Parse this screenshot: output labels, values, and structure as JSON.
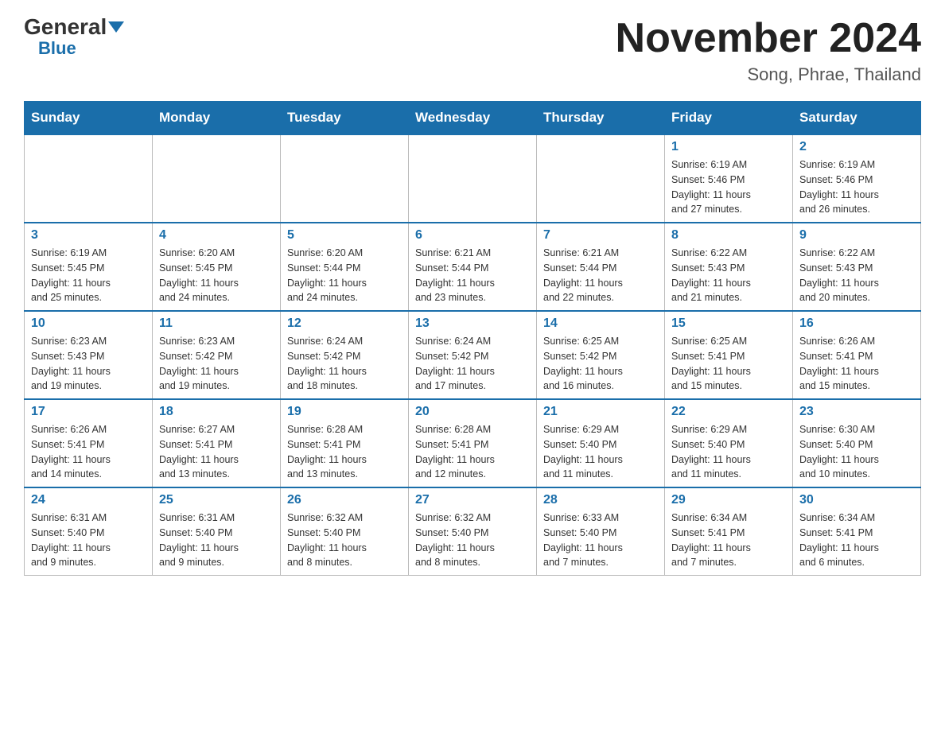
{
  "header": {
    "logo_general": "General",
    "logo_blue": "Blue",
    "month_title": "November 2024",
    "location": "Song, Phrae, Thailand"
  },
  "weekdays": [
    "Sunday",
    "Monday",
    "Tuesday",
    "Wednesday",
    "Thursday",
    "Friday",
    "Saturday"
  ],
  "weeks": [
    [
      {
        "day": "",
        "info": ""
      },
      {
        "day": "",
        "info": ""
      },
      {
        "day": "",
        "info": ""
      },
      {
        "day": "",
        "info": ""
      },
      {
        "day": "",
        "info": ""
      },
      {
        "day": "1",
        "info": "Sunrise: 6:19 AM\nSunset: 5:46 PM\nDaylight: 11 hours\nand 27 minutes."
      },
      {
        "day": "2",
        "info": "Sunrise: 6:19 AM\nSunset: 5:46 PM\nDaylight: 11 hours\nand 26 minutes."
      }
    ],
    [
      {
        "day": "3",
        "info": "Sunrise: 6:19 AM\nSunset: 5:45 PM\nDaylight: 11 hours\nand 25 minutes."
      },
      {
        "day": "4",
        "info": "Sunrise: 6:20 AM\nSunset: 5:45 PM\nDaylight: 11 hours\nand 24 minutes."
      },
      {
        "day": "5",
        "info": "Sunrise: 6:20 AM\nSunset: 5:44 PM\nDaylight: 11 hours\nand 24 minutes."
      },
      {
        "day": "6",
        "info": "Sunrise: 6:21 AM\nSunset: 5:44 PM\nDaylight: 11 hours\nand 23 minutes."
      },
      {
        "day": "7",
        "info": "Sunrise: 6:21 AM\nSunset: 5:44 PM\nDaylight: 11 hours\nand 22 minutes."
      },
      {
        "day": "8",
        "info": "Sunrise: 6:22 AM\nSunset: 5:43 PM\nDaylight: 11 hours\nand 21 minutes."
      },
      {
        "day": "9",
        "info": "Sunrise: 6:22 AM\nSunset: 5:43 PM\nDaylight: 11 hours\nand 20 minutes."
      }
    ],
    [
      {
        "day": "10",
        "info": "Sunrise: 6:23 AM\nSunset: 5:43 PM\nDaylight: 11 hours\nand 19 minutes."
      },
      {
        "day": "11",
        "info": "Sunrise: 6:23 AM\nSunset: 5:42 PM\nDaylight: 11 hours\nand 19 minutes."
      },
      {
        "day": "12",
        "info": "Sunrise: 6:24 AM\nSunset: 5:42 PM\nDaylight: 11 hours\nand 18 minutes."
      },
      {
        "day": "13",
        "info": "Sunrise: 6:24 AM\nSunset: 5:42 PM\nDaylight: 11 hours\nand 17 minutes."
      },
      {
        "day": "14",
        "info": "Sunrise: 6:25 AM\nSunset: 5:42 PM\nDaylight: 11 hours\nand 16 minutes."
      },
      {
        "day": "15",
        "info": "Sunrise: 6:25 AM\nSunset: 5:41 PM\nDaylight: 11 hours\nand 15 minutes."
      },
      {
        "day": "16",
        "info": "Sunrise: 6:26 AM\nSunset: 5:41 PM\nDaylight: 11 hours\nand 15 minutes."
      }
    ],
    [
      {
        "day": "17",
        "info": "Sunrise: 6:26 AM\nSunset: 5:41 PM\nDaylight: 11 hours\nand 14 minutes."
      },
      {
        "day": "18",
        "info": "Sunrise: 6:27 AM\nSunset: 5:41 PM\nDaylight: 11 hours\nand 13 minutes."
      },
      {
        "day": "19",
        "info": "Sunrise: 6:28 AM\nSunset: 5:41 PM\nDaylight: 11 hours\nand 13 minutes."
      },
      {
        "day": "20",
        "info": "Sunrise: 6:28 AM\nSunset: 5:41 PM\nDaylight: 11 hours\nand 12 minutes."
      },
      {
        "day": "21",
        "info": "Sunrise: 6:29 AM\nSunset: 5:40 PM\nDaylight: 11 hours\nand 11 minutes."
      },
      {
        "day": "22",
        "info": "Sunrise: 6:29 AM\nSunset: 5:40 PM\nDaylight: 11 hours\nand 11 minutes."
      },
      {
        "day": "23",
        "info": "Sunrise: 6:30 AM\nSunset: 5:40 PM\nDaylight: 11 hours\nand 10 minutes."
      }
    ],
    [
      {
        "day": "24",
        "info": "Sunrise: 6:31 AM\nSunset: 5:40 PM\nDaylight: 11 hours\nand 9 minutes."
      },
      {
        "day": "25",
        "info": "Sunrise: 6:31 AM\nSunset: 5:40 PM\nDaylight: 11 hours\nand 9 minutes."
      },
      {
        "day": "26",
        "info": "Sunrise: 6:32 AM\nSunset: 5:40 PM\nDaylight: 11 hours\nand 8 minutes."
      },
      {
        "day": "27",
        "info": "Sunrise: 6:32 AM\nSunset: 5:40 PM\nDaylight: 11 hours\nand 8 minutes."
      },
      {
        "day": "28",
        "info": "Sunrise: 6:33 AM\nSunset: 5:40 PM\nDaylight: 11 hours\nand 7 minutes."
      },
      {
        "day": "29",
        "info": "Sunrise: 6:34 AM\nSunset: 5:41 PM\nDaylight: 11 hours\nand 7 minutes."
      },
      {
        "day": "30",
        "info": "Sunrise: 6:34 AM\nSunset: 5:41 PM\nDaylight: 11 hours\nand 6 minutes."
      }
    ]
  ]
}
